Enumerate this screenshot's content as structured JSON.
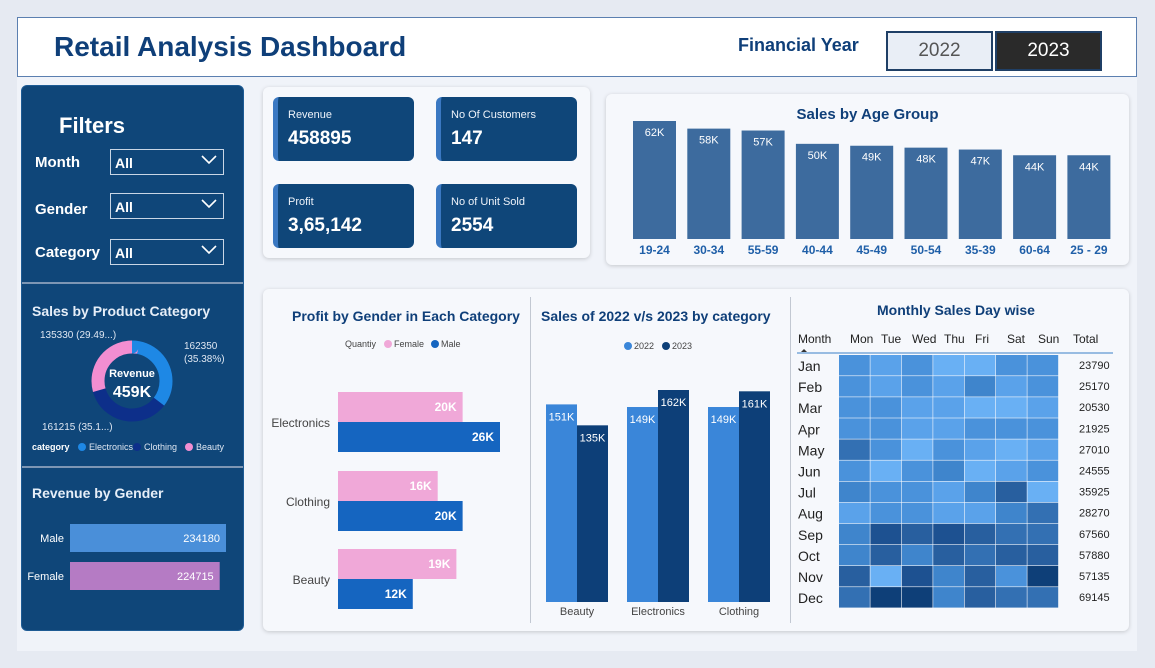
{
  "header": {
    "title": "Retail Analysis Dashboard",
    "financial_year_label": "Financial Year",
    "years": [
      "2022",
      "2023"
    ],
    "selected_year": "2023"
  },
  "filters": {
    "title": "Filters",
    "items": [
      {
        "label": "Month",
        "value": "All"
      },
      {
        "label": "Gender",
        "value": "All"
      },
      {
        "label": "Category",
        "value": "All"
      }
    ]
  },
  "kpis": [
    {
      "label": "Revenue",
      "value": "458895"
    },
    {
      "label": "No Of Customers",
      "value": "147"
    },
    {
      "label": "Profit",
      "value": "3,65,142"
    },
    {
      "label": "No of Unit Sold",
      "value": "2554"
    }
  ],
  "colors": {
    "navy": "#0f4679",
    "electronics": "#1e88e5",
    "clothing": "#0d2f8a",
    "beauty": "#f28ed1",
    "female_bar": "#f0a8d8",
    "male_bar": "#1565c0",
    "y2022": "#3a86d9",
    "y2023": "#0d3f78",
    "age_bar": "#3d6b9e",
    "rev_male": "#4a8fd9",
    "rev_female": "#b57bc4"
  },
  "chart_data": [
    {
      "id": "age",
      "type": "bar",
      "title": "Sales by Age Group",
      "categories": [
        "19-24",
        "30-34",
        "55-59",
        "40-44",
        "45-49",
        "50-54",
        "35-39",
        "60-64",
        "25 - 29"
      ],
      "values": [
        62,
        58,
        57,
        50,
        49,
        48,
        47,
        44,
        44
      ],
      "data_labels": [
        "62K",
        "58K",
        "57K",
        "50K",
        "49K",
        "48K",
        "47K",
        "44K",
        "44K"
      ]
    },
    {
      "id": "donut",
      "type": "pie",
      "title": "Sales by Product Category",
      "center_label": "Revenue",
      "center_value": "459K",
      "legend_title": "category",
      "categories": [
        "Electronics",
        "Clothing",
        "Beauty"
      ],
      "values": [
        162350,
        161215,
        135330
      ],
      "data_labels": [
        "162350 (35.38%)",
        "161215 (35.1...)",
        "135330 (29.49...)"
      ]
    },
    {
      "id": "gender_rev",
      "type": "bar",
      "title": "Revenue by Gender",
      "categories": [
        "Male",
        "Female"
      ],
      "values": [
        234180,
        224715
      ]
    },
    {
      "id": "profit_gender",
      "type": "bar",
      "title": "Profit by Gender in Each Category",
      "legend_title": "Quantiy",
      "categories": [
        "Electronics",
        "Clothing",
        "Beauty"
      ],
      "series": [
        {
          "name": "Female",
          "values": [
            20,
            16,
            19
          ],
          "data_labels": [
            "20K",
            "16K",
            "19K"
          ]
        },
        {
          "name": "Male",
          "values": [
            26,
            20,
            12
          ],
          "data_labels": [
            "26K",
            "20K",
            "12K"
          ]
        }
      ]
    },
    {
      "id": "sales_yoy",
      "type": "bar",
      "title": "Sales of 2022 v/s 2023 by category",
      "categories": [
        "Beauty",
        "Electronics",
        "Clothing"
      ],
      "series": [
        {
          "name": "2022",
          "values": [
            151,
            149,
            149
          ],
          "data_labels": [
            "151K",
            "149K",
            "149K"
          ]
        },
        {
          "name": "2023",
          "values": [
            135,
            162,
            161
          ],
          "data_labels": [
            "135K",
            "162K",
            "161K"
          ]
        }
      ]
    },
    {
      "id": "heatmap",
      "type": "heatmap",
      "title": "Monthly Sales Day wise",
      "columns": [
        "Month",
        "Mon",
        "Tue",
        "Wed",
        "Thu",
        "Fri",
        "Sat",
        "Sun",
        "Total"
      ],
      "rows": [
        {
          "month": "Jan",
          "total": "23790",
          "levels": [
            4,
            3,
            4,
            2,
            2,
            4,
            4
          ]
        },
        {
          "month": "Feb",
          "total": "25170",
          "levels": [
            4,
            3,
            4,
            3,
            5,
            3,
            4
          ]
        },
        {
          "month": "Mar",
          "total": "20530",
          "levels": [
            4,
            4,
            3,
            3,
            2,
            2,
            3
          ]
        },
        {
          "month": "Apr",
          "total": "21925",
          "levels": [
            4,
            4,
            3,
            3,
            4,
            4,
            4
          ]
        },
        {
          "month": "May",
          "total": "27010",
          "levels": [
            6,
            4,
            2,
            4,
            3,
            2,
            3
          ]
        },
        {
          "month": "Jun",
          "total": "24555",
          "levels": [
            4,
            2,
            4,
            5,
            2,
            3,
            4
          ]
        },
        {
          "month": "Jul",
          "total": "35925",
          "levels": [
            5,
            4,
            4,
            3,
            5,
            7,
            2
          ]
        },
        {
          "month": "Aug",
          "total": "28270",
          "levels": [
            3,
            4,
            4,
            3,
            3,
            5,
            6
          ]
        },
        {
          "month": "Sep",
          "total": "67560",
          "levels": [
            5,
            8,
            7,
            8,
            7,
            6,
            6
          ]
        },
        {
          "month": "Oct",
          "total": "57880",
          "levels": [
            5,
            7,
            5,
            7,
            6,
            7,
            7
          ]
        },
        {
          "month": "Nov",
          "total": "57135",
          "levels": [
            7,
            2,
            8,
            5,
            7,
            4,
            9
          ]
        },
        {
          "month": "Dec",
          "total": "69145",
          "levels": [
            6,
            9,
            9,
            5,
            7,
            6,
            6
          ]
        }
      ]
    }
  ]
}
